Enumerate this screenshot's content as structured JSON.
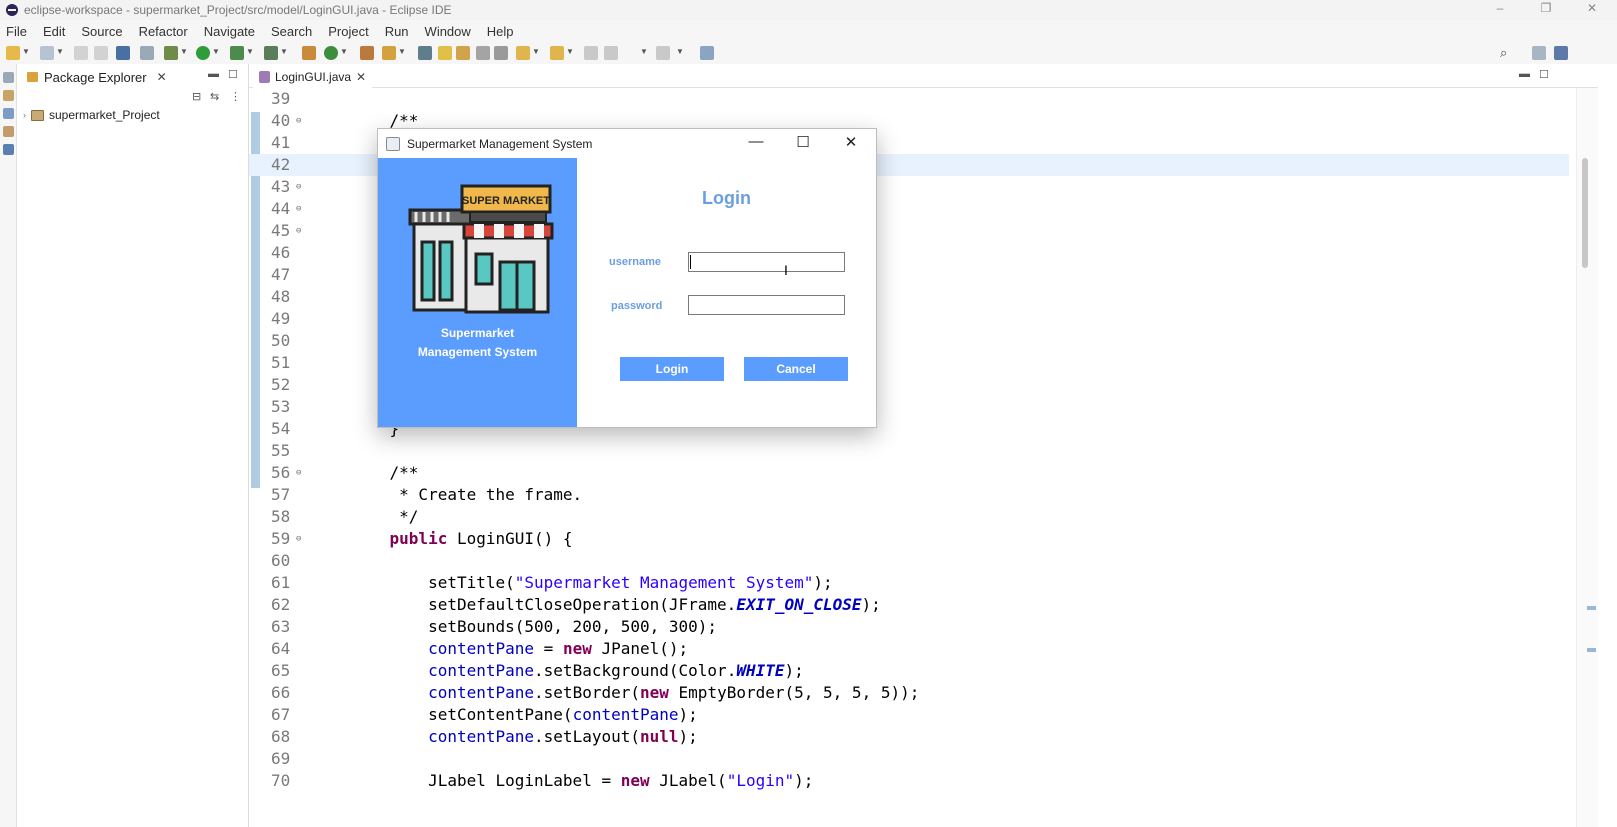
{
  "window": {
    "title": "eclipse-workspace - supermarket_Project/src/model/LoginGUI.java - Eclipse IDE",
    "controls": [
      "–",
      "❐",
      "✕"
    ]
  },
  "menu": [
    "File",
    "Edit",
    "Source",
    "Refactor",
    "Navigate",
    "Search",
    "Project",
    "Run",
    "Window",
    "Help"
  ],
  "package_explorer": {
    "tab_label": "Package Explorer",
    "project": "supermarket_Project"
  },
  "editor": {
    "tab_label": "LoginGUI.java",
    "lines": [
      {
        "n": "39",
        "t": ""
      },
      {
        "n": "40",
        "t": "    /**"
      },
      {
        "n": "41",
        "t": "     *"
      },
      {
        "n": "42",
        "t": "     *"
      },
      {
        "n": "43",
        "t": "    pul"
      },
      {
        "n": "44",
        "t": ""
      },
      {
        "n": "45",
        "t": ""
      },
      {
        "n": "46",
        "t": ""
      },
      {
        "n": "47",
        "t": "                                                  );"
      },
      {
        "n": "48",
        "t": ""
      },
      {
        "n": "49",
        "t": ""
      },
      {
        "n": "50",
        "t": ""
      },
      {
        "n": "51",
        "t": ""
      },
      {
        "n": "52",
        "t": ""
      },
      {
        "n": "53",
        "t": ""
      },
      {
        "n": "54",
        "t": "    }"
      },
      {
        "n": "55",
        "t": ""
      },
      {
        "n": "56",
        "t": "    /**"
      },
      {
        "n": "57",
        "t": "     * Create the frame."
      },
      {
        "n": "58",
        "t": "     */"
      },
      {
        "n": "59",
        "t": "    public LoginGUI() {"
      },
      {
        "n": "60",
        "t": ""
      },
      {
        "n": "61",
        "t": "        setTitle(\"Supermarket Management System\");"
      },
      {
        "n": "62",
        "t": "        setDefaultCloseOperation(JFrame.EXIT_ON_CLOSE);"
      },
      {
        "n": "63",
        "t": "        setBounds(500, 200, 500, 300);"
      },
      {
        "n": "64",
        "t": "        contentPane = new JPanel();"
      },
      {
        "n": "65",
        "t": "        contentPane.setBackground(Color.WHITE);"
      },
      {
        "n": "66",
        "t": "        contentPane.setBorder(new EmptyBorder(5, 5, 5, 5));"
      },
      {
        "n": "67",
        "t": "        setContentPane(contentPane);"
      },
      {
        "n": "68",
        "t": "        contentPane.setLayout(null);"
      },
      {
        "n": "69",
        "t": ""
      },
      {
        "n": "70",
        "t": "        JLabel LoginLabel = new JLabel(\"Login\");"
      }
    ]
  },
  "dialog": {
    "title": "Supermarket Management System",
    "sign_text": "SUPER MARKET",
    "caption_line1": "Supermarket",
    "caption_line2": "Management System",
    "heading": "Login",
    "username_label": "username",
    "password_label": "password",
    "username_value": "",
    "password_value": "",
    "login_button": "Login",
    "cancel_button": "Cancel",
    "controls": [
      "—",
      "☐",
      "✕"
    ]
  },
  "colors": {
    "accent_blue": "#5b9cff",
    "label_blue": "#6a9fe0",
    "keyword": "#7f0055",
    "string": "#2a00ff",
    "comment": "#3f5fbf"
  }
}
